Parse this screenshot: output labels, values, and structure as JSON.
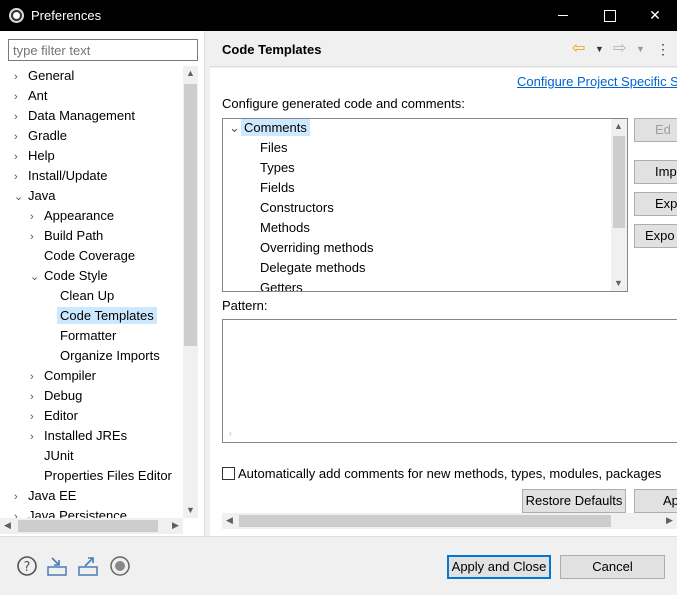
{
  "window": {
    "title": "Preferences"
  },
  "filter": {
    "placeholder": "type filter text"
  },
  "tree": [
    {
      "label": "General",
      "arrow": "›",
      "level": 0
    },
    {
      "label": "Ant",
      "arrow": "›",
      "level": 0
    },
    {
      "label": "Data Management",
      "arrow": "›",
      "level": 0
    },
    {
      "label": "Gradle",
      "arrow": "›",
      "level": 0
    },
    {
      "label": "Help",
      "arrow": "›",
      "level": 0
    },
    {
      "label": "Install/Update",
      "arrow": "›",
      "level": 0
    },
    {
      "label": "Java",
      "arrow": "⌄",
      "level": 0
    },
    {
      "label": "Appearance",
      "arrow": "›",
      "level": 1
    },
    {
      "label": "Build Path",
      "arrow": "›",
      "level": 1
    },
    {
      "label": "Code Coverage",
      "arrow": "",
      "level": 1
    },
    {
      "label": "Code Style",
      "arrow": "⌄",
      "level": 1
    },
    {
      "label": "Clean Up",
      "arrow": "",
      "level": 2
    },
    {
      "label": "Code Templates",
      "arrow": "",
      "level": 2,
      "selected": true
    },
    {
      "label": "Formatter",
      "arrow": "",
      "level": 2
    },
    {
      "label": "Organize Imports",
      "arrow": "",
      "level": 2
    },
    {
      "label": "Compiler",
      "arrow": "›",
      "level": 1
    },
    {
      "label": "Debug",
      "arrow": "›",
      "level": 1
    },
    {
      "label": "Editor",
      "arrow": "›",
      "level": 1
    },
    {
      "label": "Installed JREs",
      "arrow": "›",
      "level": 1
    },
    {
      "label": "JUnit",
      "arrow": "",
      "level": 1
    },
    {
      "label": "Properties Files Editor",
      "arrow": "",
      "level": 1
    },
    {
      "label": "Java EE",
      "arrow": "›",
      "level": 0
    },
    {
      "label": "Java Persistence",
      "arrow": "›",
      "level": 0
    }
  ],
  "header": {
    "title": "Code Templates"
  },
  "content": {
    "config_link": "Configure Project Specific S",
    "configure_label": "Configure generated code and comments:",
    "pattern_label": "Pattern:",
    "checkbox_label": "Automatically add comments for new methods, types, modules, packages",
    "checkbox_checked": false
  },
  "templates": [
    {
      "label": "Comments",
      "arrow": "⌄",
      "level": 0,
      "selected": true
    },
    {
      "label": "Files",
      "level": 1
    },
    {
      "label": "Types",
      "level": 1
    },
    {
      "label": "Fields",
      "level": 1
    },
    {
      "label": "Constructors",
      "level": 1
    },
    {
      "label": "Methods",
      "level": 1
    },
    {
      "label": "Overriding methods",
      "level": 1
    },
    {
      "label": "Delegate methods",
      "level": 1
    },
    {
      "label": "Getters",
      "level": 1
    }
  ],
  "side_buttons": {
    "edit": "Ed",
    "import": "Imp",
    "export": "Exp",
    "export_all": "Expo"
  },
  "buttons": {
    "restore_defaults": "Restore Defaults",
    "apply": "Ap",
    "apply_and_close": "Apply and Close",
    "cancel": "Cancel"
  },
  "colors": {
    "selection": "#cce8ff",
    "link": "#0066cc",
    "titlebar": "#000000",
    "focus_border": "#0078d7"
  }
}
